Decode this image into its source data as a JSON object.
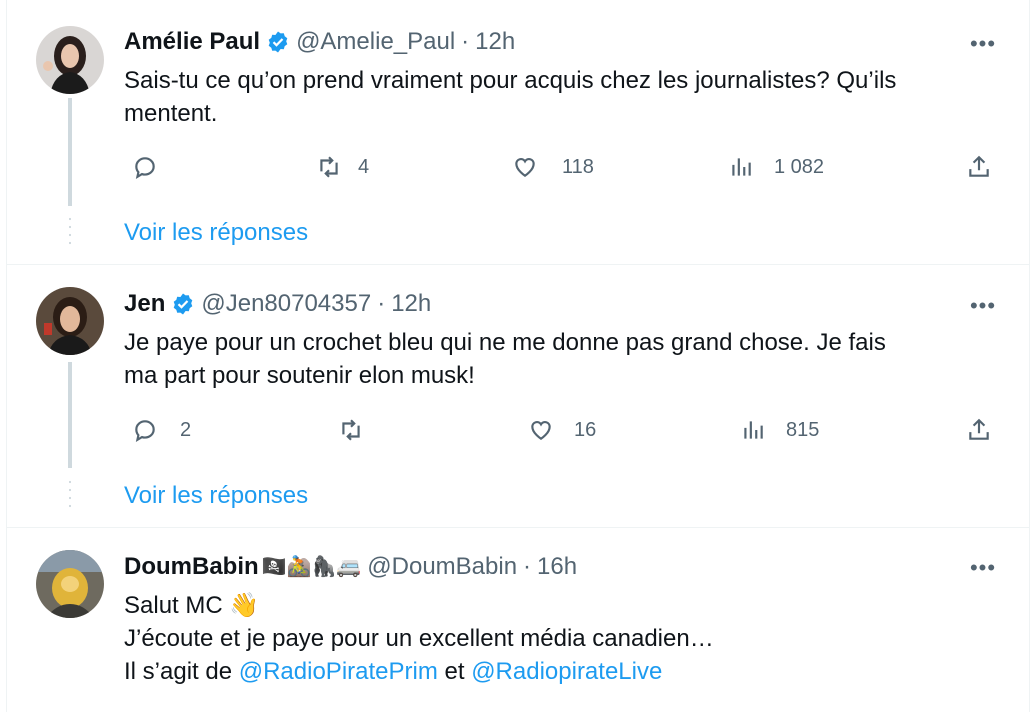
{
  "tweets": [
    {
      "name": "Amélie Paul",
      "handle": "@Amelie_Paul",
      "sep": "·",
      "time": "12h",
      "verified": true,
      "text_lines": [
        "Sais-tu ce qu’on prend vraiment pour acquis chez les journalistes? Qu’ils",
        "mentent."
      ],
      "replies": "",
      "retweets": "4",
      "likes": "118",
      "views": "1 082",
      "show_replies": "Voir les réponses"
    },
    {
      "name": "Jen",
      "handle": "@Jen80704357",
      "sep": "·",
      "time": "12h",
      "verified": true,
      "text_lines": [
        "Je paye pour un crochet bleu qui ne me donne pas grand chose. Je fais",
        "ma part pour soutenir elon musk!"
      ],
      "replies": "2",
      "retweets": "",
      "likes": "16",
      "views": "815",
      "show_replies": "Voir les réponses"
    },
    {
      "name": "DoumBabin",
      "name_emojis": "🏴‍☠️🚵🦍🚐",
      "handle": "@DoumBabin",
      "sep": "·",
      "time": "16h",
      "verified": false,
      "line1": "Salut MC",
      "line1_emoji": "👋",
      "line2": "J’écoute et je paye pour un excellent média canadien…",
      "line3_prefix": "Il s’agit de",
      "mention1": "@RadioPiratePrim",
      "conj": "et",
      "mention2": "@RadiopirateLive"
    }
  ],
  "more_icon": "•••",
  "colors": {
    "accent": "#1d9bf0",
    "muted": "#536471",
    "text": "#0f1419",
    "line": "#cfd9de"
  }
}
